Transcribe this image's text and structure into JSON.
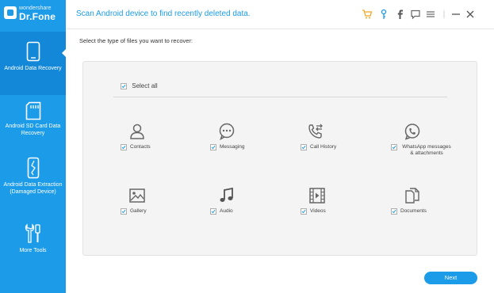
{
  "logo": {
    "small": "wondershare",
    "big": "Dr.Fone"
  },
  "header": {
    "title": "Scan Android device to find recently deleted data.",
    "icons": [
      "cart-icon",
      "key-icon",
      "facebook-icon",
      "chat-icon",
      "menu-icon",
      "minimize-icon",
      "close-icon"
    ]
  },
  "sidebar": {
    "items": [
      {
        "label": "Android Data Recovery",
        "active": true
      },
      {
        "label": "Android SD Card Data Recovery",
        "active": false
      },
      {
        "label": "Android Data Extraction (Damaged Device)",
        "active": false
      },
      {
        "label": "More Tools",
        "active": false
      }
    ]
  },
  "main": {
    "instruction": "Select the type of files you want to recover:",
    "select_all": {
      "label": "Select all",
      "checked": true
    },
    "file_types": [
      {
        "label": "Contacts",
        "icon": "contact-icon",
        "checked": true
      },
      {
        "label": "Messaging",
        "icon": "message-icon",
        "checked": true
      },
      {
        "label": "Call History",
        "icon": "call-history-icon",
        "checked": true
      },
      {
        "label": "WhatsApp messages & attachments",
        "icon": "whatsapp-icon",
        "checked": true
      },
      {
        "label": "Gallery",
        "icon": "gallery-icon",
        "checked": true
      },
      {
        "label": "Audio",
        "icon": "audio-icon",
        "checked": true
      },
      {
        "label": "Videos",
        "icon": "video-icon",
        "checked": true
      },
      {
        "label": "Documents",
        "icon": "document-icon",
        "checked": true
      }
    ],
    "next_label": "Next"
  },
  "colors": {
    "accent": "#1c9be9",
    "cart": "#f5a623"
  }
}
